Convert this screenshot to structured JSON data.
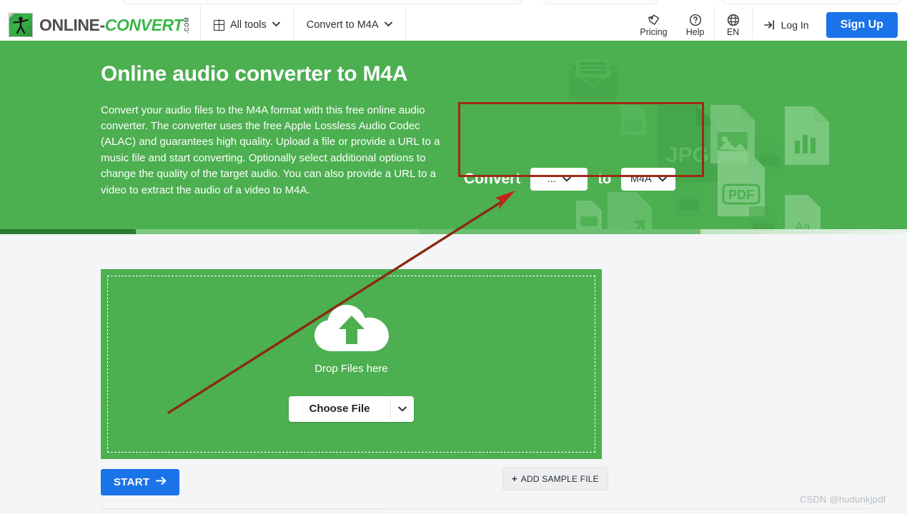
{
  "colors": {
    "brand_green": "#4caf50",
    "accent_blue": "#1a73e8",
    "annotation_red": "#9e2a13",
    "page_bg": "#f4f5f6"
  },
  "header": {
    "logo": {
      "primary": "ONLINE-",
      "secondary": "CONVERT",
      "suffix": ".COM",
      "icon": "person-logo-icon"
    },
    "nav": [
      {
        "label": "All tools",
        "icon": "grid-icon",
        "chevron": "⌄"
      },
      {
        "label": "Convert to M4A",
        "chevron": "⌄"
      }
    ],
    "utils": [
      {
        "label": "Pricing",
        "icon": "price-tag-icon"
      },
      {
        "label": "Help",
        "icon": "question-circle-icon"
      },
      {
        "label": "EN",
        "icon": "globe-icon"
      }
    ],
    "login_label": "Log In",
    "signup_label": "Sign Up"
  },
  "hero": {
    "title": "Online audio converter to M4A",
    "description": "Convert your audio files to the M4A format with this free online audio converter. The converter uses the free Apple Lossless Audio Codec (ALAC) and guarantees high quality. Upload a file or provide a URL to a music file and start converting. Optionally select additional options to change the quality of the target audio. You can also provide a URL to a video to extract the audio of a video to M4A.",
    "convert": {
      "convert_label": "Convert",
      "to_label": "to",
      "source_value": "...",
      "target_value": "M4A",
      "chevron": "⌄"
    }
  },
  "upload": {
    "drop_text": "Drop Files here",
    "choose_label": "Choose File",
    "choose_chevron": "⌄",
    "cloud_icon": "cloud-upload-icon"
  },
  "actions": {
    "start_label": "START",
    "start_arrow": "→",
    "sample_label": "ADD SAMPLE FILE",
    "sample_plus": "+"
  },
  "watermark": "CSDN @hudunkjpdf"
}
